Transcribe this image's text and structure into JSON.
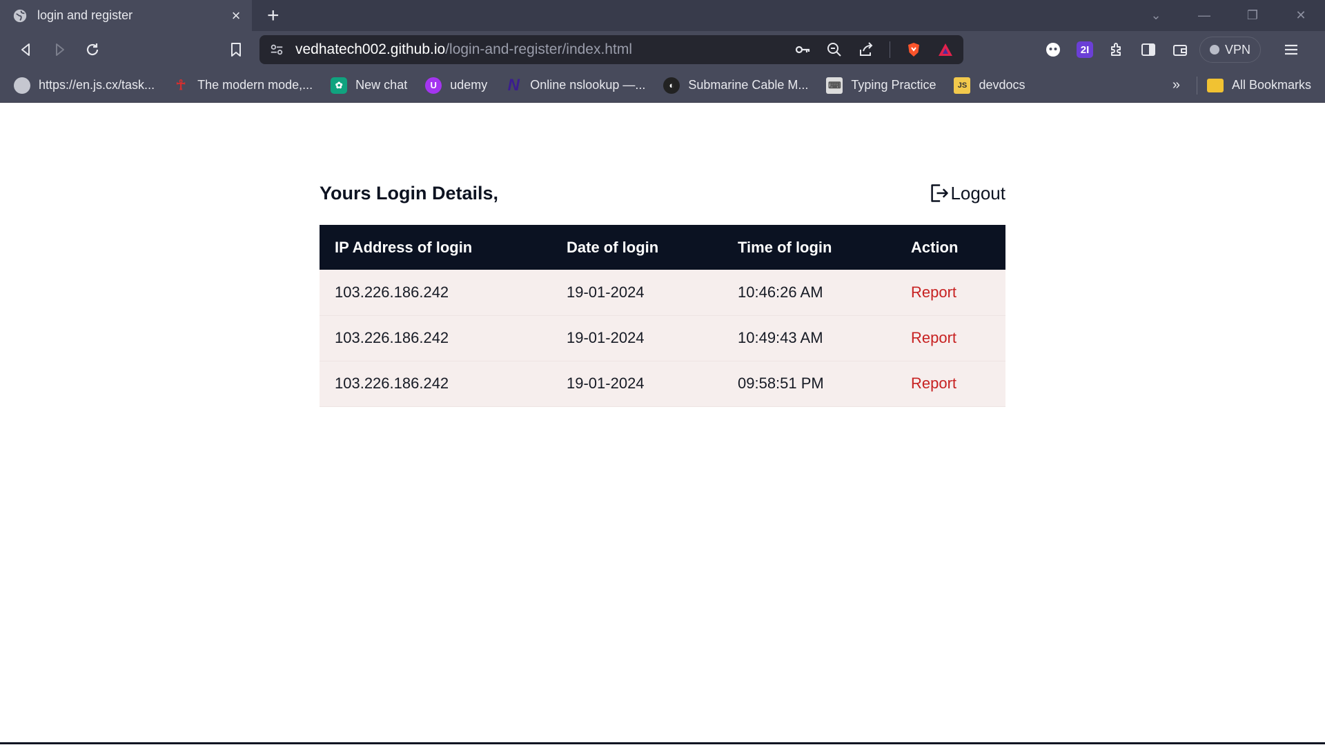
{
  "browser": {
    "tab_title": "login and register",
    "url_host": "vedhatech002.github.io",
    "url_path": "/login-and-register/index.html",
    "vpn_label": "VPN",
    "badge_label": "2I",
    "bookmarks": [
      {
        "label": "https://en.js.cx/task...",
        "icon": "globe-icon",
        "color": "#c5c7d0"
      },
      {
        "label": "The modern mode,...",
        "icon": "js-person-icon",
        "color": "#d32f2f"
      },
      {
        "label": "New chat",
        "icon": "chatgpt-icon",
        "color": "#10a37f"
      },
      {
        "label": "udemy",
        "icon": "udemy-icon",
        "color": "#a435f0"
      },
      {
        "label": "Online nslookup —...",
        "icon": "n-icon",
        "color": "#3b1d8f"
      },
      {
        "label": "Submarine Cable M...",
        "icon": "earth-icon",
        "color": "#222222"
      },
      {
        "label": "Typing Practice",
        "icon": "keyboard-icon",
        "color": "#dddddd"
      },
      {
        "label": "devdocs",
        "icon": "devdocs-icon",
        "color": "#f2c94c"
      }
    ],
    "more_label": "»",
    "all_bookmarks_label": "All Bookmarks"
  },
  "page": {
    "heading": "Yours Login Details,",
    "logout_label": "Logout",
    "table": {
      "headers": [
        "IP Address of login",
        "Date of login",
        "Time of login",
        "Action"
      ],
      "rows": [
        {
          "ip": "103.226.186.242",
          "date": "19-01-2024",
          "time": "10:46:26 AM",
          "action": "Report"
        },
        {
          "ip": "103.226.186.242",
          "date": "19-01-2024",
          "time": "10:49:43 AM",
          "action": "Report"
        },
        {
          "ip": "103.226.186.242",
          "date": "19-01-2024",
          "time": "09:58:51 PM",
          "action": "Report"
        }
      ]
    }
  },
  "colors": {
    "header_bg": "#0b1222",
    "row_bg": "#f6eeed",
    "report": "#c72121"
  }
}
